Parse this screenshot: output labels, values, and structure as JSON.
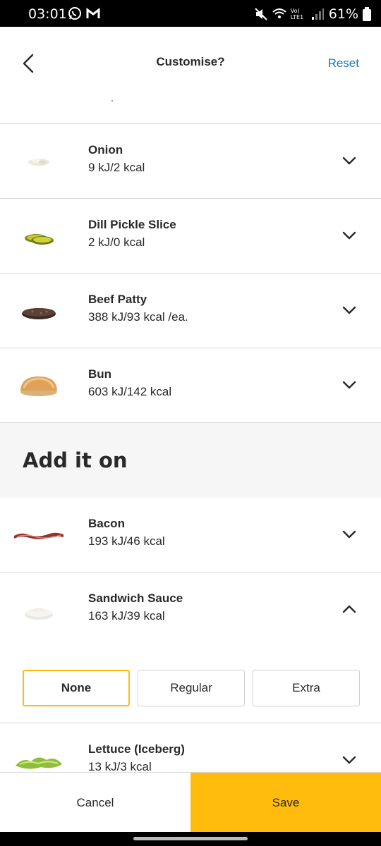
{
  "status_bar": {
    "time": "03:01",
    "battery": "61%",
    "network": "Vo) LTE1",
    "app_icons": [
      "whatsapp-icon",
      "gmail-icon"
    ],
    "icons": [
      "mute-icon",
      "wifi-icon",
      "signal-icon",
      "battery-icon"
    ]
  },
  "header": {
    "title": "Customise?",
    "reset_label": "Reset"
  },
  "ingredients": [
    {
      "name": "Onion",
      "kcal": "9 kJ/2 kcal"
    },
    {
      "name": "Dill Pickle Slice",
      "kcal": "2 kJ/0 kcal"
    },
    {
      "name": "Beef Patty",
      "kcal": "388 kJ/93 kcal /ea."
    },
    {
      "name": "Bun",
      "kcal": "603 kJ/142 kcal"
    }
  ],
  "add_section": {
    "title": "Add it on",
    "items": [
      {
        "name": "Bacon",
        "kcal": "193 kJ/46 kcal"
      },
      {
        "name": "Sandwich Sauce",
        "kcal": "163 kJ/39 kcal",
        "options": [
          "None",
          "Regular",
          "Extra"
        ],
        "selected": "None"
      },
      {
        "name": "Lettuce (Iceberg)",
        "kcal": "13 kJ/3 kcal"
      }
    ]
  },
  "footer": {
    "cancel_label": "Cancel",
    "save_label": "Save"
  },
  "colors": {
    "accent": "#ffbc0d",
    "link": "#1c75bc",
    "text": "#292929",
    "divider": "#d9d9d9",
    "section_bg": "#f6f6f6"
  }
}
